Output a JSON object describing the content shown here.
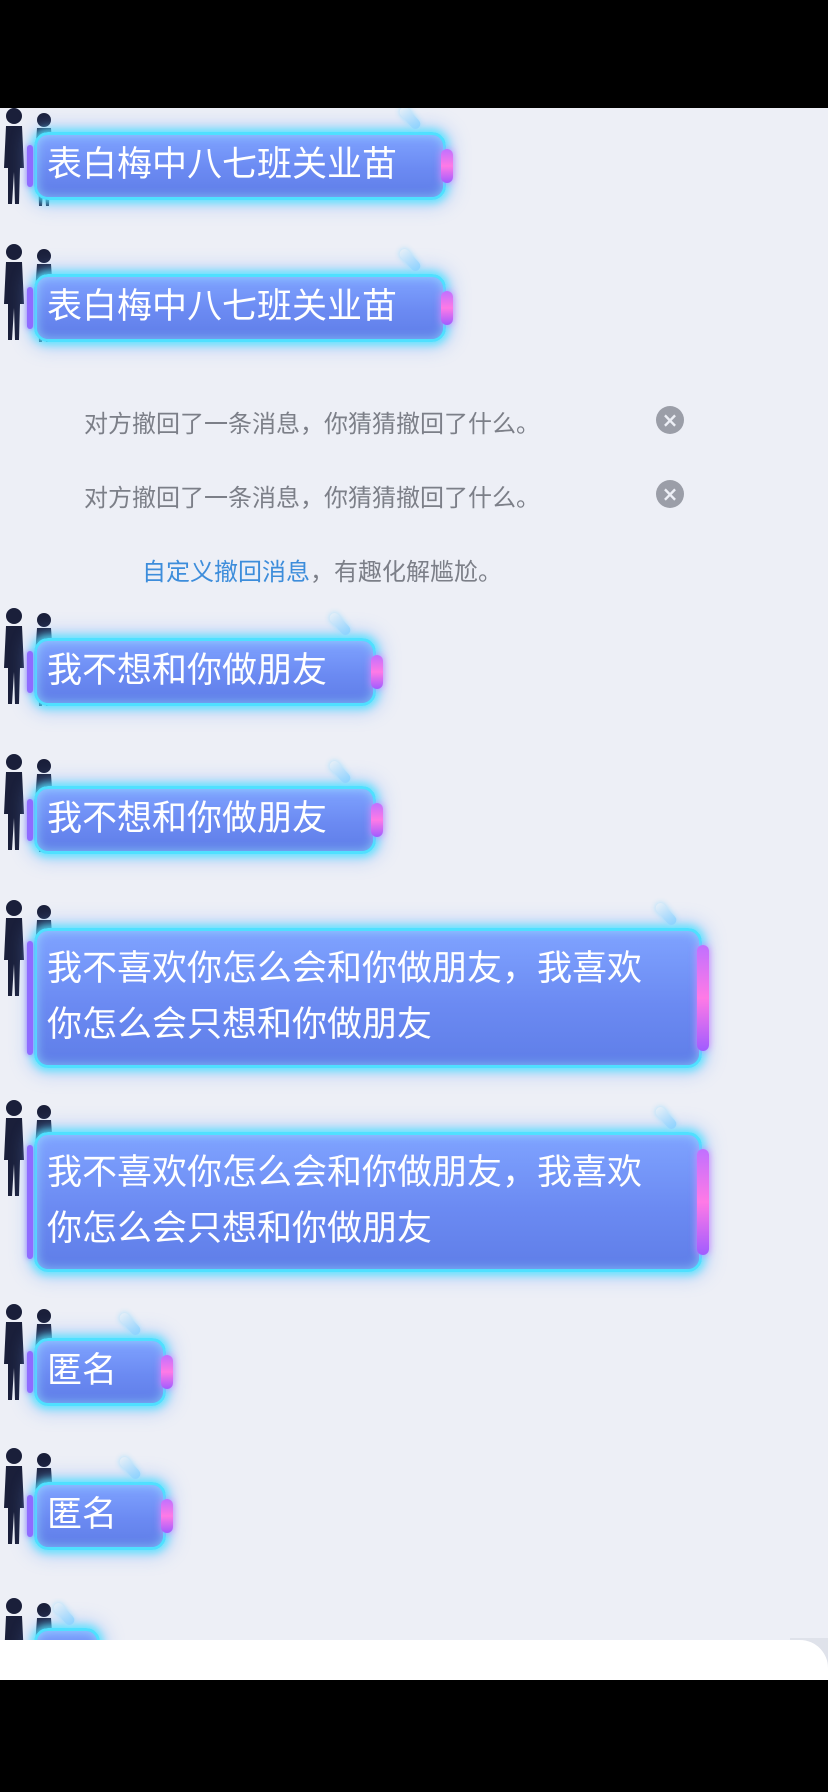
{
  "messages": [
    {
      "text": "表白梅中八七班关业苗"
    },
    {
      "text": "表白梅中八七班关业苗"
    },
    {
      "text": "我不想和你做朋友"
    },
    {
      "text": "我不想和你做朋友"
    },
    {
      "text": "我不喜欢你怎么会和你做朋友，我喜欢你怎么会只想和你做朋友"
    },
    {
      "text": "我不喜欢你怎么会和你做朋友，我喜欢你怎么会只想和你做朋友"
    },
    {
      "text": "匿名"
    },
    {
      "text": "匿名"
    }
  ],
  "notices": {
    "recall_1": "对方撤回了一条消息，你猜猜撤回了什么。",
    "recall_2": "对方撤回了一条消息，你猜猜撤回了什么。",
    "close_glyph": "×",
    "custom_link": "自定义撤回消息",
    "custom_rest": "，有趣化解尴尬。"
  },
  "colors": {
    "chat_background": "#edeff6",
    "bubble_fill": "#6b8af2",
    "bubble_glow": "#4fe0ff",
    "bubble_edge": "#ff7ae6",
    "link": "#3d8ddb",
    "notice_text": "#7c7f88"
  },
  "icons": {
    "avatar": "couple-silhouette-icon",
    "dismiss": "close-circle-icon"
  }
}
